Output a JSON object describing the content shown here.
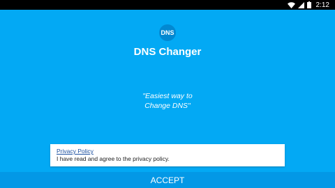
{
  "status_bar": {
    "time": "2:12",
    "icons": [
      "wifi-icon",
      "signal-icon",
      "battery-icon"
    ]
  },
  "app": {
    "logo_text": "DNS",
    "title": "DNS Changer",
    "tagline_line1": "\"Easiest way to",
    "tagline_line2": "Change DNS\""
  },
  "privacy": {
    "link_label": "Privacy Policy",
    "agreement_text": "I have read and agree to the privacy policy."
  },
  "footer": {
    "accept_label": "ACCEPT"
  },
  "colors": {
    "background": "#03a9f4",
    "button": "#0398e6",
    "logo": "#0288d1",
    "status_bar": "#000000"
  }
}
